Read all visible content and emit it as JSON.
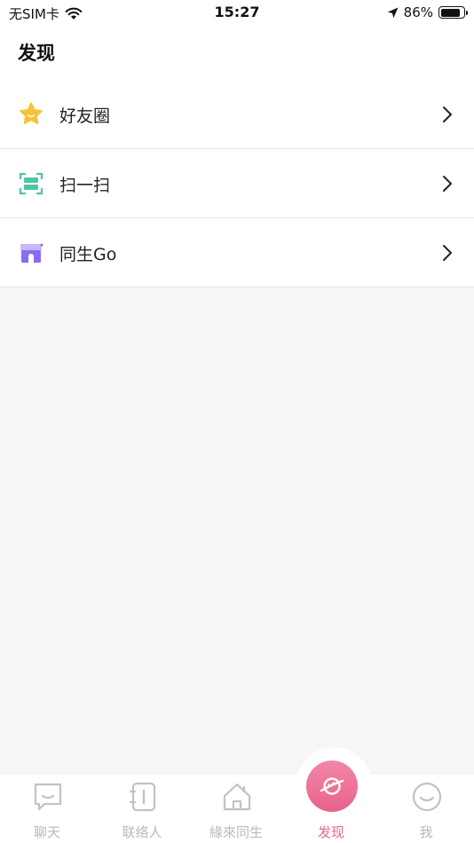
{
  "status_bar": {
    "carrier": "无SIM卡",
    "time": "15:27",
    "battery": "86%",
    "battery_level": 0.86
  },
  "header": {
    "title": "发现"
  },
  "menu": {
    "items": [
      {
        "label": "好友圈",
        "icon": "star-icon"
      },
      {
        "label": "扫一扫",
        "icon": "scan-icon"
      },
      {
        "label": "同生Go",
        "icon": "store-icon"
      }
    ]
  },
  "tabbar": {
    "tabs": [
      {
        "label": "聊天",
        "icon": "chat-icon"
      },
      {
        "label": "联络人",
        "icon": "contacts-icon"
      },
      {
        "label": "緣來同生",
        "icon": "home-icon"
      },
      {
        "label": "发现",
        "icon": "planet-icon"
      },
      {
        "label": "我",
        "icon": "smile-icon"
      }
    ],
    "active_index": 3
  },
  "colors": {
    "accent": "#e8668f",
    "tab_inactive": "#b9b9b9",
    "background": "#f7f6f7",
    "star": "#f6c338",
    "scan": "#4fc3a5",
    "store": "#8b6cf0"
  }
}
